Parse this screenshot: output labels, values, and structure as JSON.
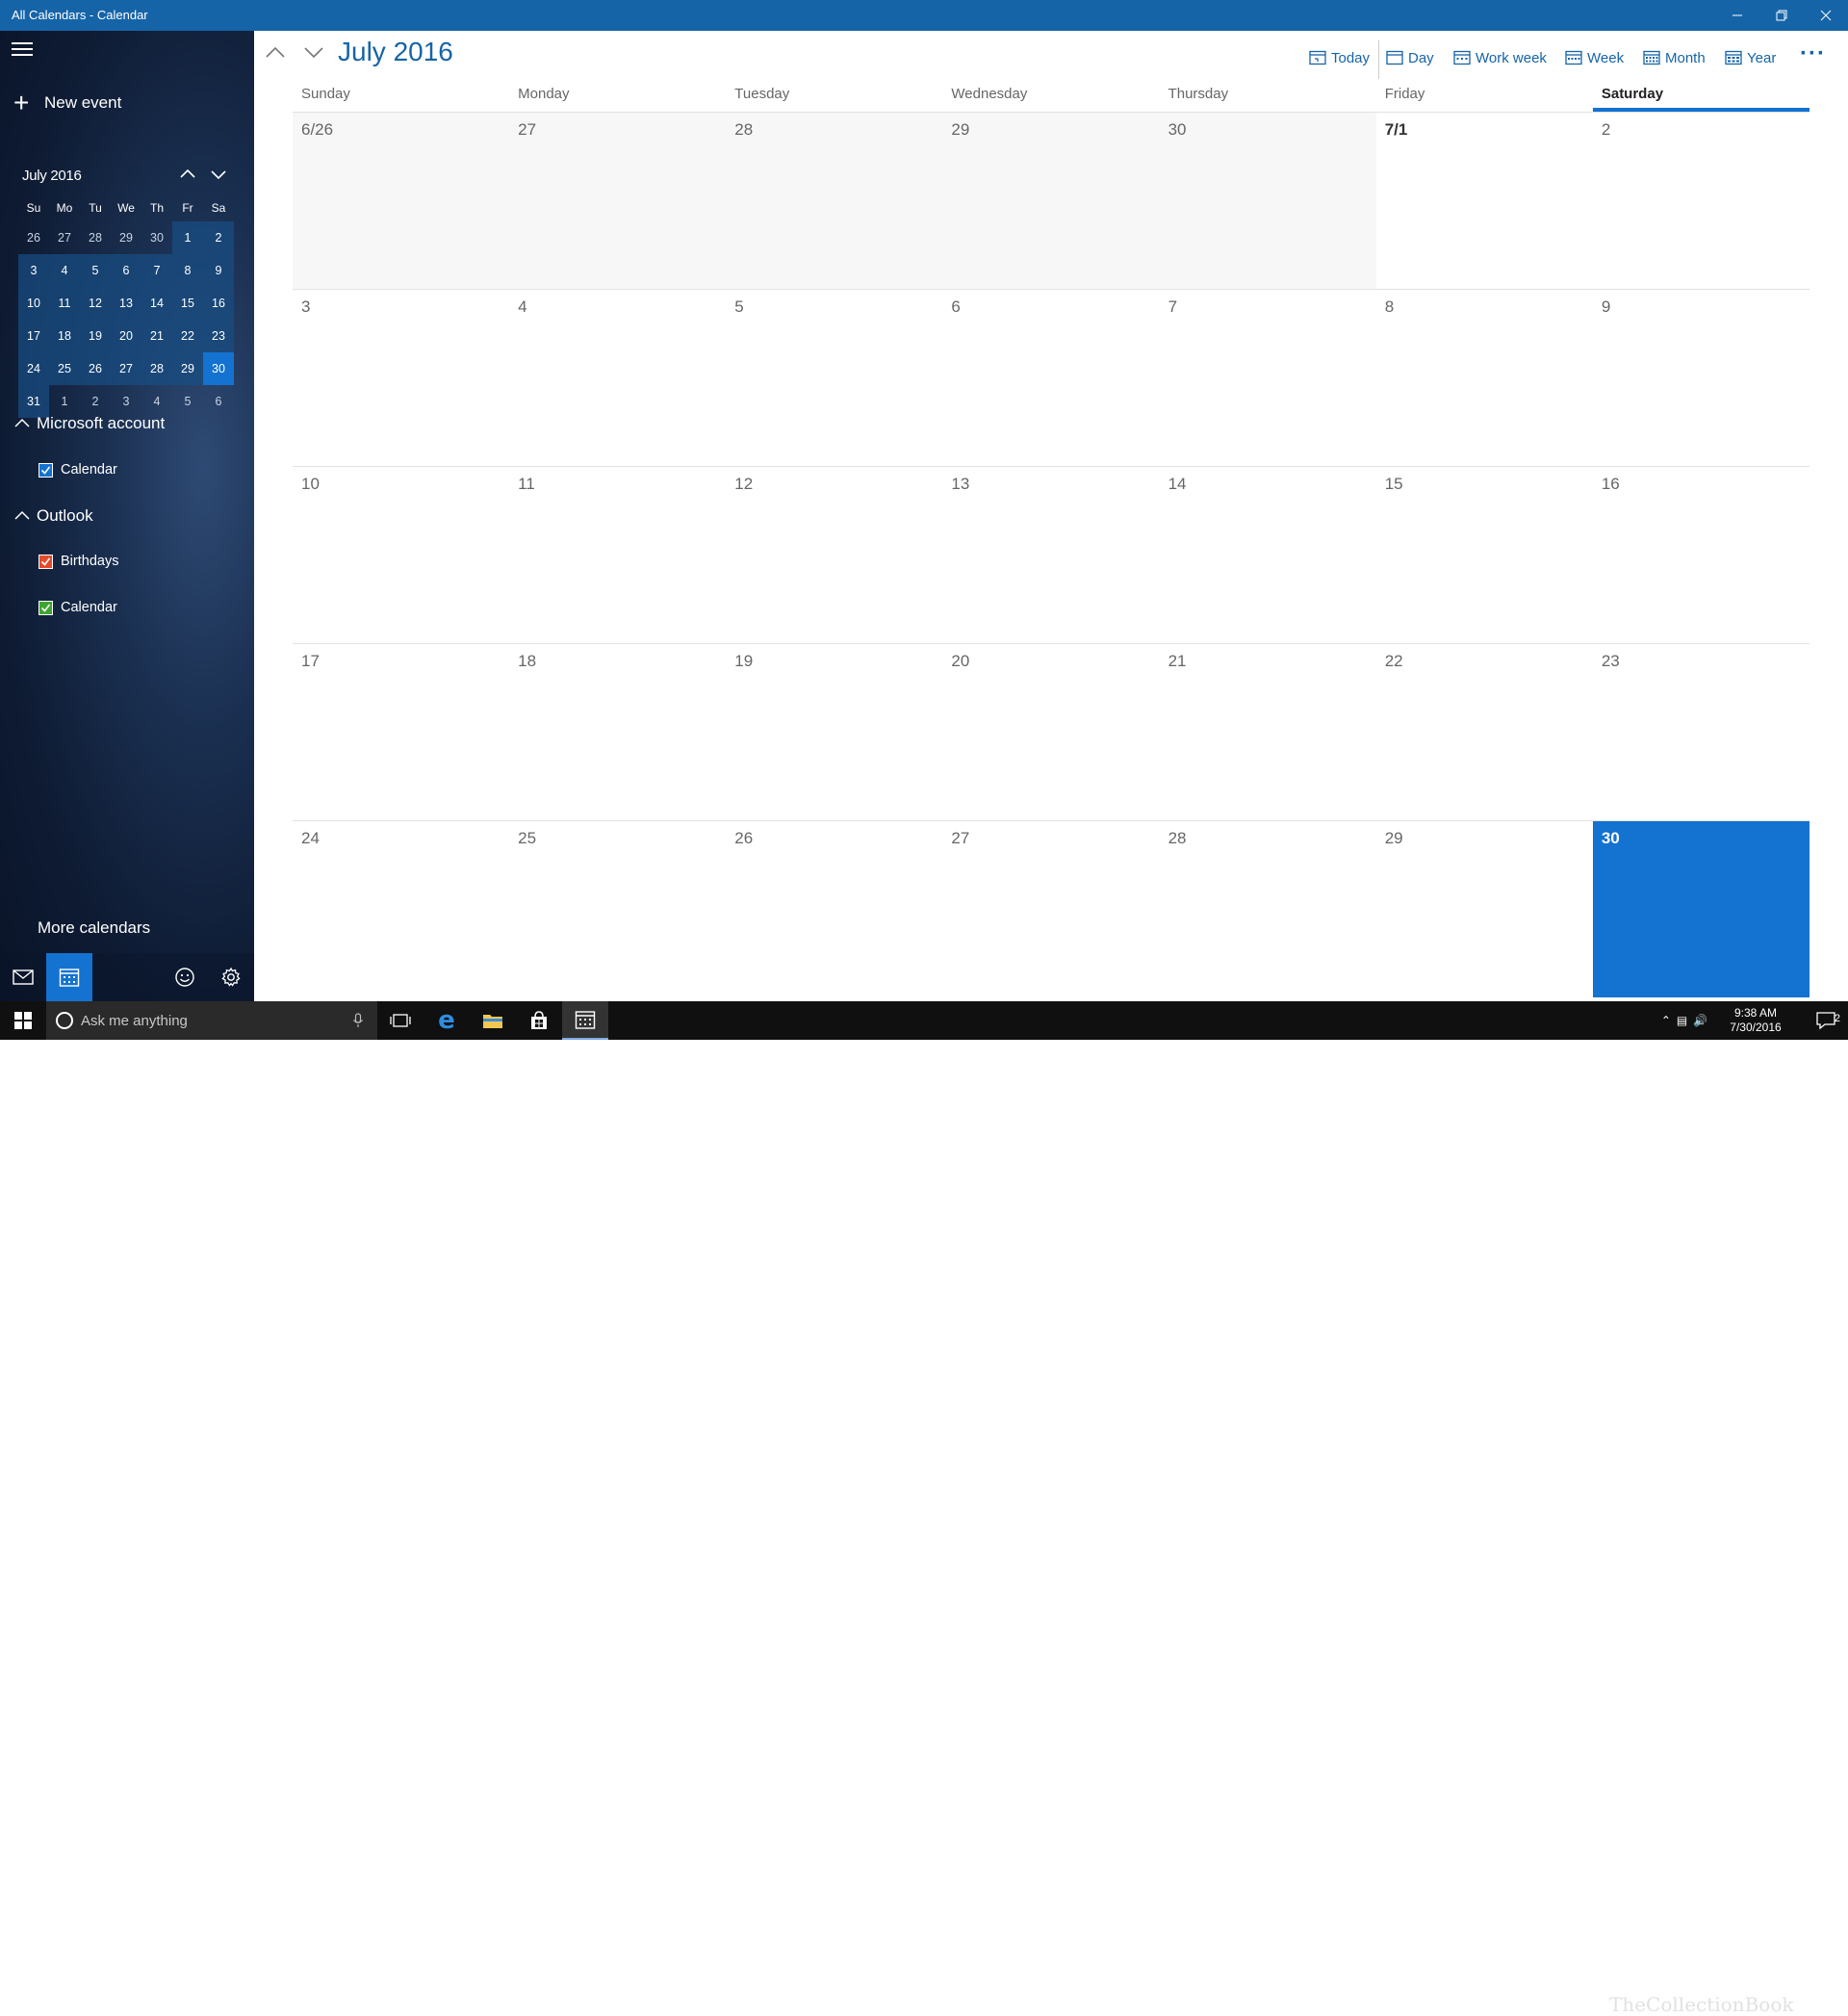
{
  "window": {
    "title": "All Calendars - Calendar"
  },
  "sidebar": {
    "new_event": "New event",
    "mini_calendar": {
      "month": "July 2016",
      "weekdays": [
        "Su",
        "Mo",
        "Tu",
        "We",
        "Th",
        "Fr",
        "Sa"
      ],
      "weeks": [
        [
          "26",
          "27",
          "28",
          "29",
          "30",
          "1",
          "2"
        ],
        [
          "3",
          "4",
          "5",
          "6",
          "7",
          "8",
          "9"
        ],
        [
          "10",
          "11",
          "12",
          "13",
          "14",
          "15",
          "16"
        ],
        [
          "17",
          "18",
          "19",
          "20",
          "21",
          "22",
          "23"
        ],
        [
          "24",
          "25",
          "26",
          "27",
          "28",
          "29",
          "30"
        ],
        [
          "31",
          "1",
          "2",
          "3",
          "4",
          "5",
          "6"
        ]
      ]
    },
    "accounts": [
      {
        "name": "Microsoft account",
        "calendars": [
          {
            "label": "Calendar",
            "color": "#1472d0"
          }
        ]
      },
      {
        "name": "Outlook",
        "calendars": [
          {
            "label": "Birthdays",
            "color": "#e24c2c"
          },
          {
            "label": "Calendar",
            "color": "#3ea52f"
          }
        ]
      }
    ],
    "more_calendars": "More calendars"
  },
  "main": {
    "month_title": "July 2016",
    "toolbar": {
      "today": "Today",
      "day": "Day",
      "work_week": "Work week",
      "week": "Week",
      "month": "Month",
      "year": "Year"
    },
    "weekday_headers": [
      "Sunday",
      "Monday",
      "Tuesday",
      "Wednesday",
      "Thursday",
      "Friday",
      "Saturday"
    ],
    "weeks": [
      [
        "6/26",
        "27",
        "28",
        "29",
        "30",
        "7/1",
        "2"
      ],
      [
        "3",
        "4",
        "5",
        "6",
        "7",
        "8",
        "9"
      ],
      [
        "10",
        "11",
        "12",
        "13",
        "14",
        "15",
        "16"
      ],
      [
        "17",
        "18",
        "19",
        "20",
        "21",
        "22",
        "23"
      ],
      [
        "24",
        "25",
        "26",
        "27",
        "28",
        "29",
        "30"
      ]
    ]
  },
  "taskbar": {
    "search_placeholder": "Ask me anything",
    "time": "9:38 AM",
    "date": "7/30/2016",
    "notification_count": "2"
  },
  "watermark": "TheCollectionBook",
  "colors": {
    "accent": "#1472d0",
    "titlebar": "#1664a8"
  }
}
